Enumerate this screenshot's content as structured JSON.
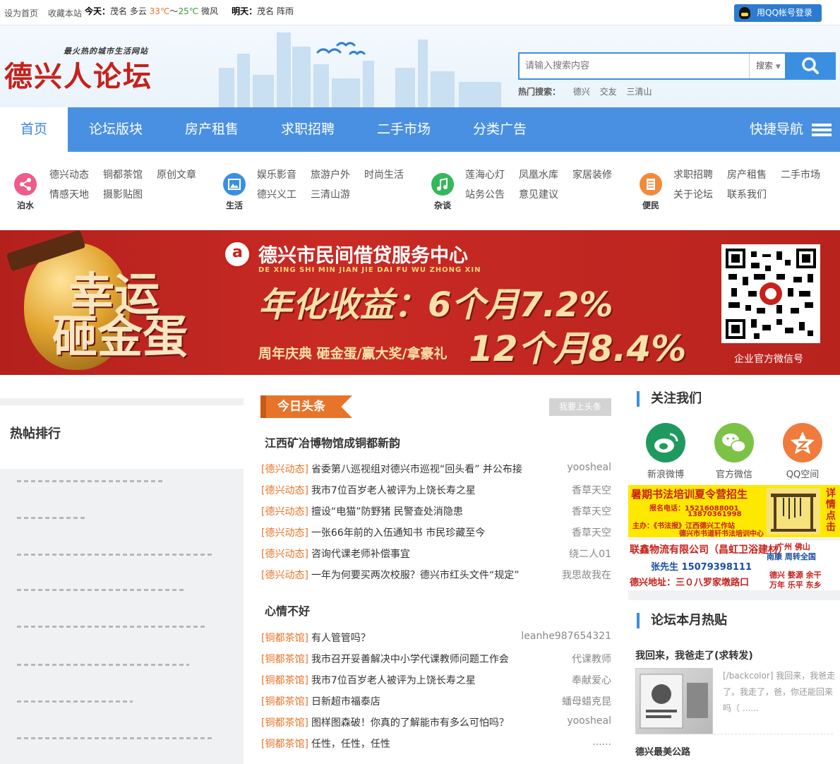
{
  "topbar": {
    "set_home": "设为首页",
    "bookmark": "收藏本站",
    "today_label": "今天：",
    "today_text": "茂名 多云",
    "today_hi": "33℃",
    "today_sep": "～",
    "today_lo": "25℃",
    "today_wind": "微风",
    "tomorrow_label": "明天：",
    "tomorrow_text": "茂名 阵雨",
    "qq_login": "用QQ帐号登录"
  },
  "header": {
    "slogan": "最火热的城市生活网站",
    "logo": "德兴人论坛",
    "search_placeholder": "请输入搜索内容",
    "search_select": "搜索",
    "hot_label": "热门搜索：",
    "hot_terms": [
      "德兴",
      "交友",
      "三清山"
    ]
  },
  "nav": {
    "items": [
      "首页",
      "论坛版块",
      "房产租售",
      "求职招聘",
      "二手市场",
      "分类广告"
    ],
    "quick": "快捷导航"
  },
  "categories": [
    {
      "label": "泊水",
      "color": "#ee5c8a",
      "icon": "share-icon",
      "links": [
        "德兴动态",
        "铜都茶馆",
        "原创文章",
        "情感天地",
        "摄影贴图"
      ]
    },
    {
      "label": "生活",
      "color": "#3b8fe0",
      "icon": "picture-icon",
      "links": [
        "娱乐影音",
        "旅游户外",
        "时尚生活",
        "德兴义工",
        "三清山游"
      ]
    },
    {
      "label": "杂谈",
      "color": "#35b85a",
      "icon": "music-icon",
      "links": [
        "莲海心灯",
        "凤凰水库",
        "家居装修",
        "站务公告",
        "意见建议"
      ]
    },
    {
      "label": "便民",
      "color": "#f28a3c",
      "icon": "document-icon",
      "links": [
        "求职招聘",
        "房产租售",
        "二手市场",
        "关于论坛",
        "联系我们"
      ]
    }
  ],
  "banner": {
    "big1": "幸运",
    "big2": "砸金蛋",
    "title": "德兴市民间借贷服务中心",
    "subtitle": "DE XING SHI MIN JIAN JIE DAI FU WU ZHONG XIN",
    "rate1": "年化收益：6个月7.2%",
    "rate2": "12个月8.4%",
    "footer": "周年庆典  砸金蛋/赢大奖/拿豪礼",
    "qr_caption": "企业官方微信号"
  },
  "left": {
    "hot_title": "热帖排行"
  },
  "headlines": {
    "tag": "今日头条",
    "button": "我要上头条",
    "sections": [
      {
        "title": "江西矿冶博物馆成铜都新韵",
        "rows": [
          {
            "cat": "[德兴动态]",
            "title": "省委第八巡视组对德兴市巡视“回头看” 并公布接",
            "author": "yoosheal"
          },
          {
            "cat": "[德兴动态]",
            "title": "我市7位百岁老人被评为上饶长寿之星",
            "author": "香草天空"
          },
          {
            "cat": "[德兴动态]",
            "title": "擅设“电猫”防野猪 民警查处消隐患",
            "author": "香草天空"
          },
          {
            "cat": "[德兴动态]",
            "title": "一张66年前的入伍通知书 市民珍藏至今",
            "author": "香草天空"
          },
          {
            "cat": "[德兴动态]",
            "title": "咨询代课老师补偿事宜",
            "author": "绕二人01"
          },
          {
            "cat": "[德兴动态]",
            "title": "一年为何要买两次校服？德兴市红头文件“规定”",
            "author": "我思故我在"
          }
        ]
      },
      {
        "title": "心情不好",
        "rows": [
          {
            "cat": "[铜都茶馆]",
            "title": "有人管管吗？",
            "author": "leanhe987654321"
          },
          {
            "cat": "[铜都茶馆]",
            "title": "我市召开妥善解决中小学代课教师问题工作会",
            "author": "代课教师"
          },
          {
            "cat": "[铜都茶馆]",
            "title": "我市7位百岁老人被评为上饶长寿之星",
            "author": "奉献爱心"
          },
          {
            "cat": "[铜都茶馆]",
            "title": "日新超市福泰店",
            "author": "蟠母蜡克昆"
          },
          {
            "cat": "[铜都茶馆]",
            "title": "图样图森破！你真的了解能市有多么可怕吗？",
            "author": "yoosheal"
          },
          {
            "cat": "[铜都茶馆]",
            "title": "任性，任性，任性",
            "author": "......"
          }
        ]
      }
    ]
  },
  "right": {
    "follow_title": "关注我们",
    "social": [
      {
        "label": "新浪微博",
        "icon": "weibo-icon",
        "color": "#1f9a5f"
      },
      {
        "label": "官方微信",
        "icon": "wechat-icon",
        "color": "#7cc245"
      },
      {
        "label": "QQ空间",
        "icon": "qzone-icon",
        "color": "#f07b3c"
      }
    ],
    "ad1": {
      "title": "暑期书法培训夏令营招生",
      "phone_label": "报名电话：",
      "phone1": "15216088001",
      "phone2": "13870361998",
      "host": "主办：《书法报》江西德兴工作站",
      "host2": "德兴市书道轩书法培训中心",
      "side": "详情点击"
    },
    "ad2": {
      "company": "联鑫物流有限公司（昌虹卫浴建材）",
      "contact": "张先生 15079398111",
      "address": "德兴地址：三０八罗家墩路口",
      "cities1": "广州 佛山",
      "cities2": "南康 周转全国",
      "cities3": "德兴 婺源 余干",
      "cities4": "万年 乐平 东乡"
    },
    "monthly_title": "论坛本月热贴",
    "post_title": "我回来，我爸走了(求转发)",
    "post_excerpt": "[/backcolor] 我回来，我爸走了。我走了，爸，你还能回来吗（ ......",
    "post2_title": "德兴最美公路"
  }
}
